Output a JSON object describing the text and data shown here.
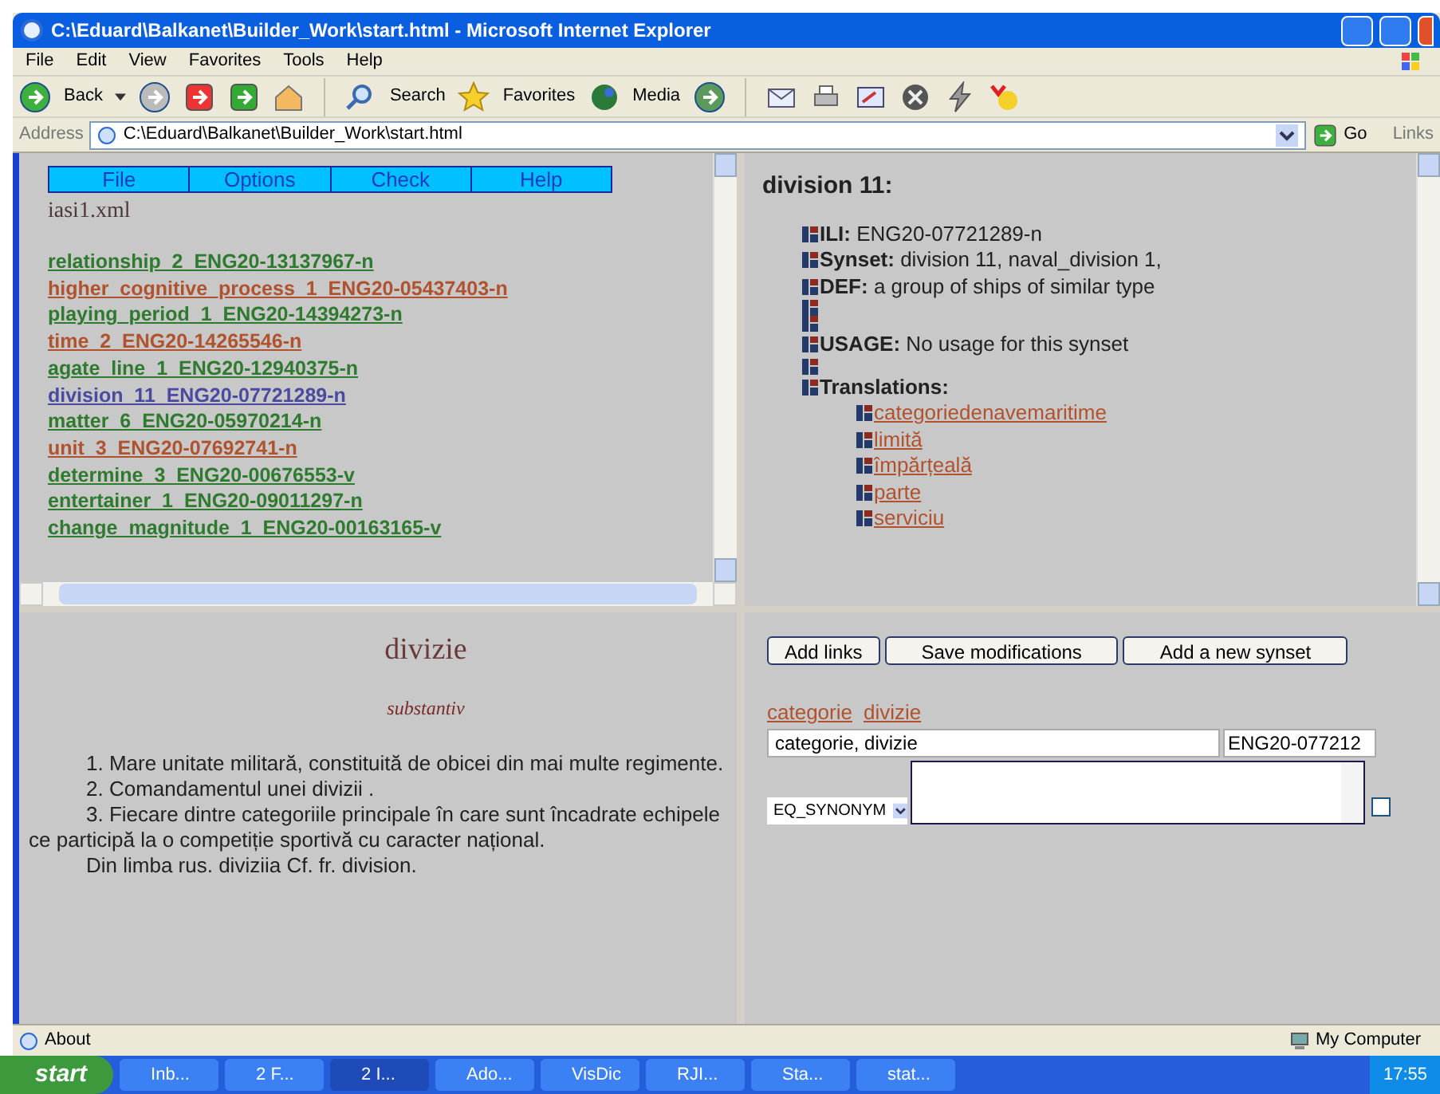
{
  "window": {
    "title": "C:\\Eduard\\Balkanet\\Builder_Work\\start.html - Microsoft Internet Explorer"
  },
  "menu": [
    "File",
    "Edit",
    "View",
    "Favorites",
    "Tools",
    "Help"
  ],
  "toolbar": {
    "back": "Back",
    "search": "Search",
    "favorites": "Favorites",
    "media": "Media"
  },
  "address": {
    "label": "Address",
    "value": "C:\\Eduard\\Balkanet\\Builder_Work\\start.html",
    "go": "Go",
    "links": "Links"
  },
  "app_menu": [
    {
      "label": "File"
    },
    {
      "label": "Options"
    },
    {
      "label": "Check"
    },
    {
      "label": "Help"
    }
  ],
  "file_name": "iasi1.xml",
  "synset_links": [
    {
      "label": "relationship_2_ENG20-13137967-n",
      "color": "#2e7a2e"
    },
    {
      "label": "higher_cognitive_process_1_ENG20-05437403-n",
      "color": "#b0522e"
    },
    {
      "label": "playing_period_1_ENG20-14394273-n",
      "color": "#2e7a2e"
    },
    {
      "label": "time_2_ENG20-14265546-n",
      "color": "#b0522e"
    },
    {
      "label": "agate_line_1_ENG20-12940375-n",
      "color": "#2e7a2e"
    },
    {
      "label": "division_11_ENG20-07721289-n",
      "color": "#4a4aa0"
    },
    {
      "label": "matter_6_ENG20-05970214-n",
      "color": "#2e7a2e"
    },
    {
      "label": "unit_3_ENG20-07692741-n",
      "color": "#b0522e"
    },
    {
      "label": "determine_3_ENG20-00676553-v",
      "color": "#2e7a2e"
    },
    {
      "label": "entertainer_1_ENG20-09011297-n",
      "color": "#2e7a2e"
    },
    {
      "label": "change_magnitude_1_ENG20-00163165-v",
      "color": "#2e7a2e"
    }
  ],
  "synset": {
    "title": "division 11:",
    "fields": [
      {
        "kind": "field",
        "label": "ILI:",
        "value": "ENG20-07721289-n"
      },
      {
        "kind": "field",
        "label": "Synset:",
        "value": "division 11, naval_division 1,"
      },
      {
        "kind": "field",
        "label": "DEF:",
        "value": "a group of ships of similar type"
      },
      {
        "kind": "blank"
      },
      {
        "kind": "blank"
      },
      {
        "kind": "field",
        "label": "USAGE:",
        "value": "No usage for this synset"
      },
      {
        "kind": "blank"
      },
      {
        "kind": "field",
        "label": "Translations:"
      }
    ],
    "translations": [
      "categoriedenavemaritime",
      "limită",
      "împărțeală",
      "parte",
      "serviciu"
    ]
  },
  "dictionary": {
    "headword": "divizie",
    "pos": "substantiv",
    "senses": [
      "1. Mare unitate militară, constituită de obicei din mai multe regimente.",
      "2. Comandamentul unei divizii .",
      "3. Fiecare dintre categoriile principale în care sunt încadrate echipele ce participă la o competiție sportivă cu caracter național.",
      "Din limba rus. diviziia Cf. fr. division."
    ]
  },
  "editor": {
    "buttons": [
      "Add links",
      "Save modifications",
      "Add a new synset"
    ],
    "literal_links": [
      "categorie",
      "divizie"
    ],
    "literals_value": "categorie, divizie",
    "id_value": "ENG20-077212",
    "relation": "EQ_SYNONYM",
    "checked": false
  },
  "status_bar": {
    "left": "About",
    "right": "My Computer"
  },
  "taskbar": {
    "start": "start",
    "items": [
      "Inb...",
      "2 F...",
      "2 I...",
      "Ado...",
      "VisDic",
      "RJI...",
      "Sta...",
      "stat..."
    ],
    "clock": "17:55"
  }
}
